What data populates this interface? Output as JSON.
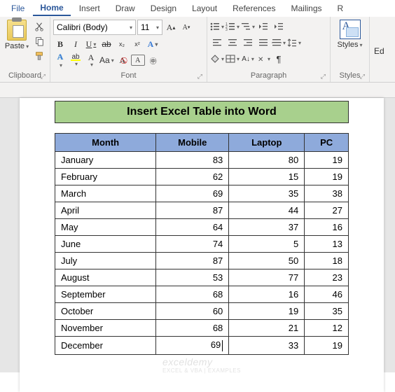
{
  "menu": {
    "file": "File",
    "home": "Home",
    "insert": "Insert",
    "draw": "Draw",
    "design": "Design",
    "layout": "Layout",
    "references": "References",
    "mailings": "Mailings",
    "r": "R"
  },
  "ribbon": {
    "clipboard": {
      "paste": "Paste",
      "label": "Clipboard"
    },
    "font": {
      "name": "Calibri (Body)",
      "size": "11",
      "label": "Font",
      "bold": "B",
      "italic": "I",
      "underline": "U",
      "strike": "ab",
      "sub": "x₂",
      "sup": "x²",
      "textfx": "A",
      "highlight": "",
      "fontcolor": "A",
      "caseAa": "Aa",
      "clear": "A̸",
      "grow": "A",
      "shrink": "A"
    },
    "paragraph": {
      "label": "Paragraph"
    },
    "styles": {
      "button": "Styles",
      "label": "Styles"
    },
    "editing": {
      "label": "Ed"
    }
  },
  "document": {
    "title": "Insert Excel Table into Word",
    "headers": [
      "Month",
      "Mobile",
      "Laptop",
      "PC"
    ],
    "rows": [
      {
        "month": "January",
        "mobile": 83,
        "laptop": 80,
        "pc": 19
      },
      {
        "month": "February",
        "mobile": 62,
        "laptop": 15,
        "pc": 19
      },
      {
        "month": "March",
        "mobile": 69,
        "laptop": 35,
        "pc": 38
      },
      {
        "month": "April",
        "mobile": 87,
        "laptop": 44,
        "pc": 27
      },
      {
        "month": "May",
        "mobile": 64,
        "laptop": 37,
        "pc": 16
      },
      {
        "month": "June",
        "mobile": 74,
        "laptop": 5,
        "pc": 13
      },
      {
        "month": "July",
        "mobile": 87,
        "laptop": 50,
        "pc": 18
      },
      {
        "month": "August",
        "mobile": 53,
        "laptop": 77,
        "pc": 23
      },
      {
        "month": "September",
        "mobile": 68,
        "laptop": 16,
        "pc": 46
      },
      {
        "month": "October",
        "mobile": 60,
        "laptop": 19,
        "pc": 35
      },
      {
        "month": "November",
        "mobile": 68,
        "laptop": 21,
        "pc": 12
      },
      {
        "month": "December",
        "mobile": 69,
        "laptop": 33,
        "pc": 19
      }
    ],
    "watermark": "exceldemy",
    "watermark_sub": "EXCEL & VBA | EXAMPLES"
  },
  "chart_data": {
    "type": "table",
    "title": "Insert Excel Table into Word",
    "categories": [
      "January",
      "February",
      "March",
      "April",
      "May",
      "June",
      "July",
      "August",
      "September",
      "October",
      "November",
      "December"
    ],
    "series": [
      {
        "name": "Mobile",
        "values": [
          83,
          62,
          69,
          87,
          64,
          74,
          87,
          53,
          68,
          60,
          68,
          69
        ]
      },
      {
        "name": "Laptop",
        "values": [
          80,
          15,
          35,
          44,
          37,
          5,
          50,
          77,
          16,
          19,
          21,
          33
        ]
      },
      {
        "name": "PC",
        "values": [
          19,
          19,
          38,
          27,
          16,
          13,
          18,
          23,
          46,
          35,
          12,
          19
        ]
      }
    ]
  }
}
